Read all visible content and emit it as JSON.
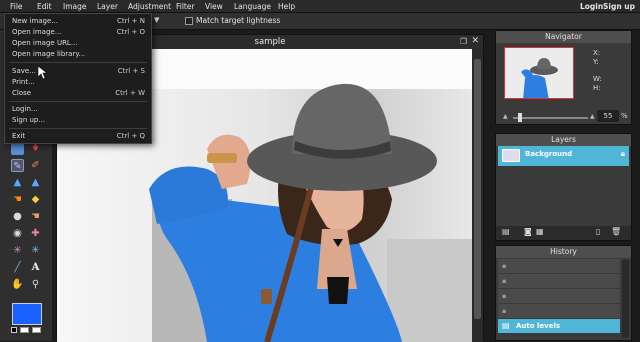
{
  "menubar": {
    "items": [
      "File",
      "Edit",
      "Image",
      "Layer",
      "Adjustment",
      "Filter",
      "View",
      "Language",
      "Help"
    ],
    "login": "Login",
    "signup": "Sign up"
  },
  "optionsbar": {
    "match_label": "Match target lightness"
  },
  "file_menu": {
    "items": [
      {
        "label": "New image...",
        "shortcut": "Ctrl + N"
      },
      {
        "label": "Open image...",
        "shortcut": "Ctrl + O"
      },
      {
        "label": "Open image URL...",
        "shortcut": ""
      },
      {
        "label": "Open image library...",
        "shortcut": ""
      },
      {
        "label": "Save...",
        "shortcut": "Ctrl + S"
      },
      {
        "label": "Print...",
        "shortcut": ""
      },
      {
        "label": "Close",
        "shortcut": "Ctrl + W"
      },
      {
        "label": "Login...",
        "shortcut": ""
      },
      {
        "label": "Sign up...",
        "shortcut": ""
      },
      {
        "label": "Exit",
        "shortcut": "Ctrl + Q"
      }
    ]
  },
  "document": {
    "title": "sample"
  },
  "navigator": {
    "title": "Navigator",
    "x_label": "X:",
    "y_label": "Y:",
    "w_label": "W:",
    "h_label": "H:",
    "zoom_value": "55",
    "zoom_unit": "%"
  },
  "layers": {
    "title": "Layers",
    "layer_name": "Background"
  },
  "history": {
    "title": "History",
    "current": "Auto levels"
  },
  "colors": {
    "foreground": "#1a62ff",
    "background": "#ffffff",
    "accent": "#4fb6d8"
  }
}
